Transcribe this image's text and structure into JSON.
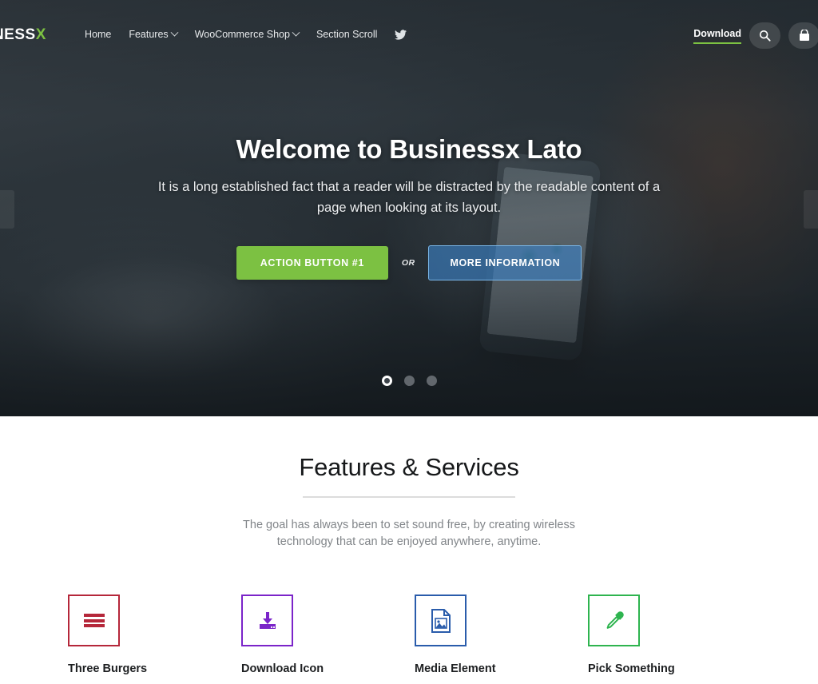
{
  "header": {
    "logo_text": "SINESSX",
    "logo_main": "SINESS",
    "logo_accent": "X",
    "nav": [
      {
        "label": "Home",
        "has_dropdown": false
      },
      {
        "label": "Features",
        "has_dropdown": true
      },
      {
        "label": "WooCommerce Shop",
        "has_dropdown": true
      },
      {
        "label": "Section Scroll",
        "has_dropdown": false
      }
    ],
    "social_icon": "twitter-icon",
    "download_label": "Download",
    "download_underline_color": "#7cc142",
    "search_icon": "search-icon",
    "cart_icon": "cart-icon"
  },
  "hero": {
    "title": "Welcome to Businessx Lato",
    "subtitle": "It is a long established fact that a reader will be distracted by the readable content of a page when looking at its layout.",
    "primary_button": "ACTION BUTTON #1",
    "or_label": "OR",
    "secondary_button": "MORE INFORMATION",
    "primary_color": "#7cc142",
    "secondary_color": "#3c82c8",
    "slides": [
      {
        "index": 1,
        "active": true
      },
      {
        "index": 2,
        "active": false
      },
      {
        "index": 3,
        "active": false
      }
    ],
    "prev_arrow": "chevron-left-icon",
    "next_arrow": "chevron-right-icon"
  },
  "features_section": {
    "title": "Features & Services",
    "description": "The goal has always been to set sound free, by creating wireless technology that can be enjoyed anywhere, anytime.",
    "items": [
      {
        "label": "Three Burgers",
        "icon": "hamburger-menu-icon",
        "color": "#b5273a"
      },
      {
        "label": "Download Icon",
        "icon": "download-icon",
        "color": "#7b24c9"
      },
      {
        "label": "Media Element",
        "icon": "image-file-icon",
        "color": "#2a5cab"
      },
      {
        "label": "Pick Something",
        "icon": "eyedropper-icon",
        "color": "#2eb martin"
      }
    ],
    "item_colors": [
      "#b5273a",
      "#7b24c9",
      "#2a5cab",
      "#2eb44f"
    ]
  }
}
